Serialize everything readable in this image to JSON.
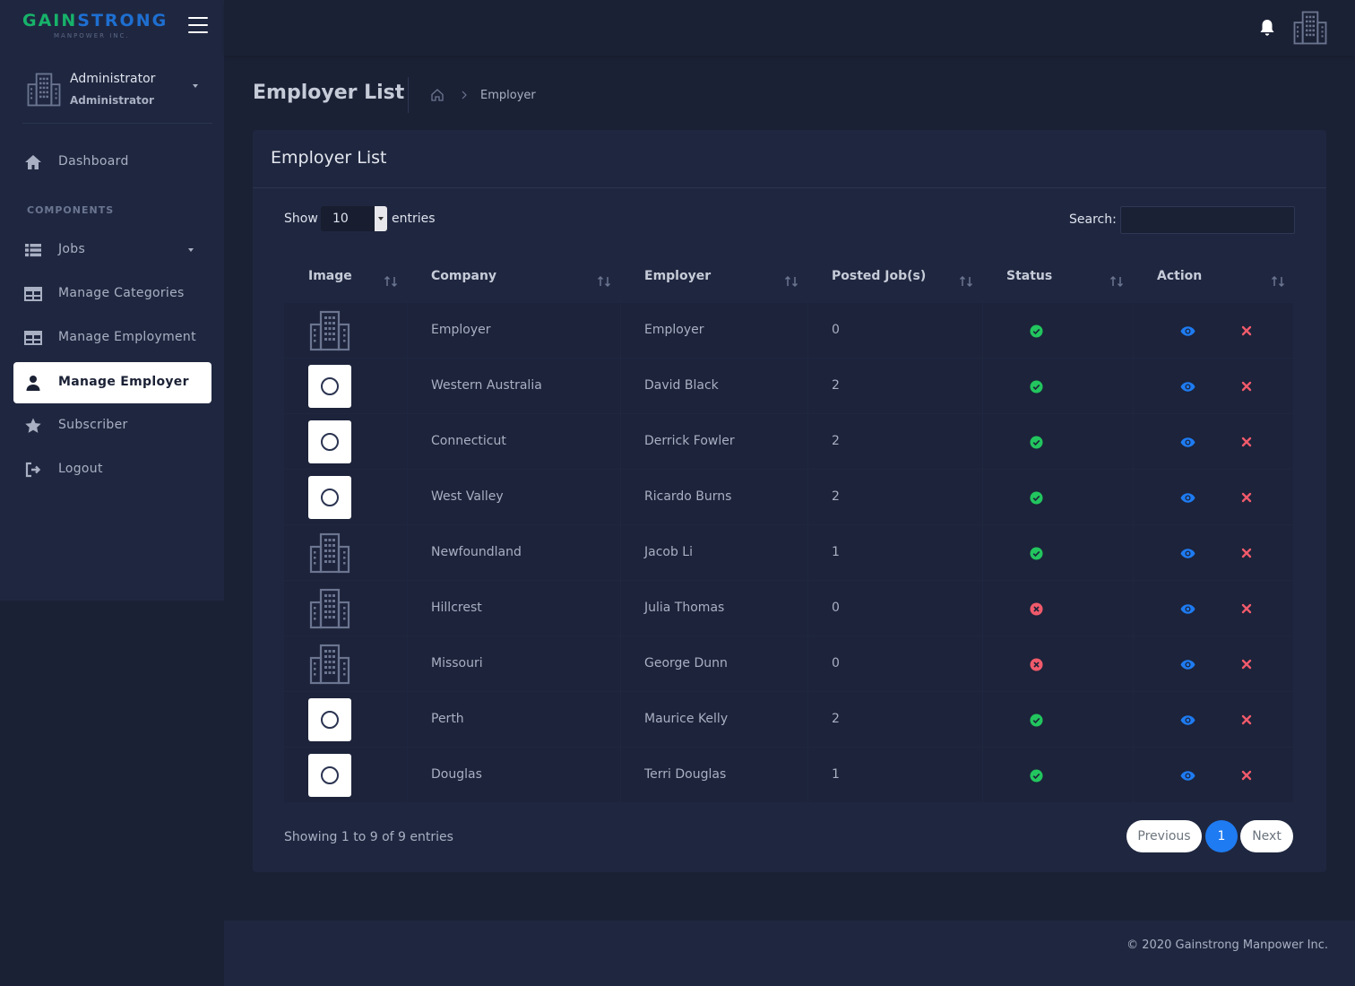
{
  "brand": {
    "name_part1": "GAIN",
    "name_part2": "STRONG",
    "tagline": "MANPOWER INC."
  },
  "user": {
    "name": "Administrator",
    "role": "Administrator"
  },
  "sidebar": {
    "section_label": "COMPONENTS",
    "items": [
      {
        "label": "Dashboard",
        "icon": "home-icon"
      },
      {
        "label": "Jobs",
        "icon": "list-icon"
      },
      {
        "label": "Manage Categories",
        "icon": "table-icon"
      },
      {
        "label": "Manage Employment",
        "icon": "table-icon"
      },
      {
        "label": "Manage Employer",
        "icon": "user-icon",
        "active": true
      },
      {
        "label": "Subscriber",
        "icon": "star-icon"
      },
      {
        "label": "Logout",
        "icon": "logout-icon"
      }
    ]
  },
  "page": {
    "title": "Employer List",
    "breadcrumb_current": "Employer"
  },
  "card": {
    "title": "Employer List"
  },
  "controls": {
    "show_label": "Show",
    "entries_value": "10",
    "entries_label": "entries",
    "search_label": "Search:",
    "search_value": ""
  },
  "table": {
    "columns": [
      "Image",
      "Company",
      "Employer",
      "Posted Job(s)",
      "Status",
      "Action"
    ],
    "rows": [
      {
        "image": "building-placeholder",
        "company": "Employer",
        "employer": "Employer",
        "posted_jobs": "0",
        "status": "active"
      },
      {
        "image": "logo",
        "company": "Western Australia",
        "employer": "David Black",
        "posted_jobs": "2",
        "status": "active"
      },
      {
        "image": "logo",
        "company": "Connecticut",
        "employer": "Derrick Fowler",
        "posted_jobs": "2",
        "status": "active"
      },
      {
        "image": "logo",
        "company": "West Valley",
        "employer": "Ricardo Burns",
        "posted_jobs": "2",
        "status": "active"
      },
      {
        "image": "building-placeholder",
        "company": "Newfoundland",
        "employer": "Jacob Li",
        "posted_jobs": "1",
        "status": "active"
      },
      {
        "image": "building-placeholder",
        "company": "Hillcrest",
        "employer": "Julia Thomas",
        "posted_jobs": "0",
        "status": "inactive"
      },
      {
        "image": "building-placeholder",
        "company": "Missouri",
        "employer": "George Dunn",
        "posted_jobs": "0",
        "status": "inactive"
      },
      {
        "image": "logo",
        "company": "Perth",
        "employer": "Maurice Kelly",
        "posted_jobs": "2",
        "status": "active"
      },
      {
        "image": "logo",
        "company": "Douglas",
        "employer": "Terri Douglas",
        "posted_jobs": "1",
        "status": "active"
      }
    ]
  },
  "pagination": {
    "summary": "Showing 1 to 9 of 9 entries",
    "previous": "Previous",
    "current": "1",
    "next": "Next"
  },
  "footer": {
    "text": "© 2020 Gainstrong Manpower Inc."
  },
  "colors": {
    "background": "#1b2135",
    "panel": "#1f2740",
    "accent": "#1e7bf2",
    "success": "#22c55e",
    "danger": "#f05a6b",
    "brand_green": "#17b26a",
    "brand_blue": "#1e6fd1"
  }
}
